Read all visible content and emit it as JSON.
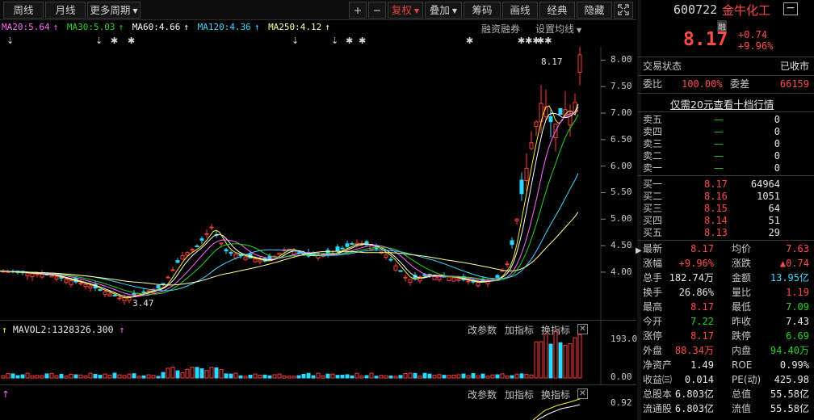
{
  "toolbar": {
    "tabs": [
      {
        "label": "周线"
      },
      {
        "label": "月线"
      },
      {
        "label": "更多周期"
      }
    ],
    "buttons": [
      {
        "label": "+"
      },
      {
        "label": "−"
      },
      {
        "label": "复权"
      },
      {
        "label": "叠加"
      },
      {
        "label": "筹码"
      },
      {
        "label": "画线"
      },
      {
        "label": "经典"
      },
      {
        "label": "隐藏"
      }
    ],
    "active_color": "#e8463c"
  },
  "ma_legend": {
    "items": [
      {
        "text": "MA20:5.64",
        "color": "#ff6aff"
      },
      {
        "text": "MA30:5.03",
        "color": "#22d422"
      },
      {
        "text": "MA60:4.66",
        "color": "#ffffff"
      },
      {
        "text": "MA120:4.36",
        "color": "#3fd8ff"
      },
      {
        "text": "MA250:4.12",
        "color": "#ffffa0"
      }
    ],
    "fin_label": "融资融券",
    "settings_label": "设置均线"
  },
  "chart_data": {
    "type": "candlestick",
    "y_ticks": [
      "8.00",
      "7.50",
      "7.00",
      "6.50",
      "6.00",
      "5.50",
      "5.00",
      "4.50",
      "4.00"
    ],
    "ylim": [
      3.1,
      8.25
    ],
    "high_label": "8.17",
    "low_label": "3.47",
    "volume_panel": {
      "label": "MAVOL2:1328326.300",
      "y_ticks": [
        "193.00",
        "0.00"
      ]
    },
    "indicator_panel": {
      "y_ticks": [
        "0.92"
      ]
    },
    "panel_buttons": [
      "改参数",
      "加指标",
      "换指标"
    ]
  },
  "quote": {
    "code": "600722",
    "name": "金牛化工",
    "price": "8.17",
    "badge": "融",
    "change": "+0.74",
    "change_pct": "+9.96%",
    "status_label": "交易状态",
    "status_value": "已收市",
    "wb_label": "委比",
    "wb_value": "100.00%",
    "wc_label": "委差",
    "wc_value": "66159",
    "promo": "仅需20元查看十档行情",
    "asks": [
      {
        "label": "卖五",
        "price": "—",
        "vol": "0"
      },
      {
        "label": "卖四",
        "price": "—",
        "vol": "0"
      },
      {
        "label": "卖三",
        "price": "—",
        "vol": "0"
      },
      {
        "label": "卖二",
        "price": "—",
        "vol": "0"
      },
      {
        "label": "卖一",
        "price": "—",
        "vol": "0"
      }
    ],
    "bids": [
      {
        "label": "买一",
        "price": "8.17",
        "vol": "64964"
      },
      {
        "label": "买二",
        "price": "8.16",
        "vol": "1051"
      },
      {
        "label": "买三",
        "price": "8.15",
        "vol": "64"
      },
      {
        "label": "买四",
        "price": "8.14",
        "vol": "51"
      },
      {
        "label": "买五",
        "price": "8.13",
        "vol": "29"
      }
    ],
    "stats": [
      {
        "l1": "最新",
        "v1": "8.17",
        "c1": "red",
        "l2": "均价",
        "v2": "7.63",
        "c2": "red"
      },
      {
        "l1": "涨幅",
        "v1": "+9.96%",
        "c1": "red",
        "l2": "涨跌",
        "v2": "▲0.74",
        "c2": "red"
      },
      {
        "l1": "总手",
        "v1": "182.74万",
        "c1": "white",
        "l2": "金额",
        "v2": "13.95亿",
        "c2": "cyan"
      },
      {
        "l1": "换手",
        "v1": "26.86%",
        "c1": "white",
        "l2": "量比",
        "v2": "1.19",
        "c2": "red"
      },
      {
        "l1": "最高",
        "v1": "8.17",
        "c1": "red",
        "l2": "最低",
        "v2": "7.09",
        "c2": "green"
      },
      {
        "l1": "今开",
        "v1": "7.22",
        "c1": "green",
        "l2": "昨收",
        "v2": "7.43",
        "c2": "white"
      },
      {
        "l1": "涨停",
        "v1": "8.17",
        "c1": "red",
        "l2": "跌停",
        "v2": "6.69",
        "c2": "green"
      },
      {
        "l1": "外盘",
        "v1": "88.34万",
        "c1": "red",
        "l2": "内盘",
        "v2": "94.40万",
        "c2": "green"
      },
      {
        "l1": "净资产",
        "v1": "1.49",
        "c1": "white",
        "l2": "ROE",
        "v2": "0.99%",
        "c2": "white"
      },
      {
        "l1": "收益㈢",
        "v1": "0.014",
        "c1": "white",
        "l2": "PE(动)",
        "v2": "425.98",
        "c2": "white"
      },
      {
        "l1": "总股本",
        "v1": "6.803亿",
        "c1": "white",
        "l2": "总值",
        "v2": "55.58亿",
        "c2": "white"
      },
      {
        "l1": "流通股",
        "v1": "6.803亿",
        "c1": "white",
        "l2": "流值",
        "v2": "55.58亿",
        "c2": "white"
      }
    ]
  }
}
